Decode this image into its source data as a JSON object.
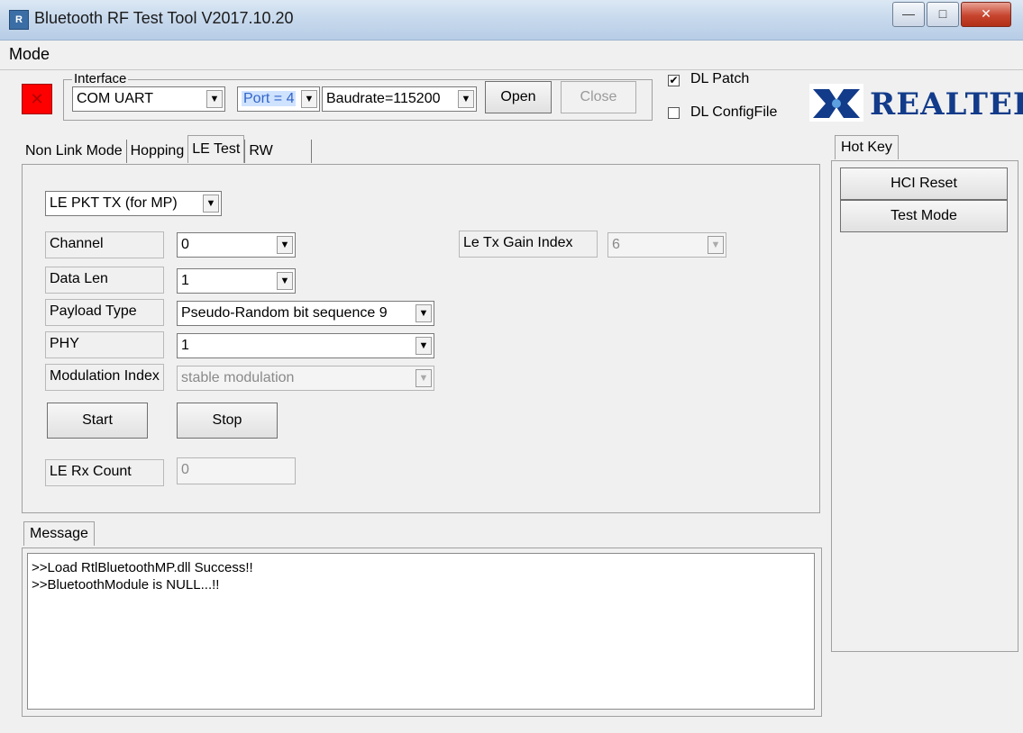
{
  "window": {
    "title": "Bluetooth RF Test Tool V2017.10.20"
  },
  "menu": {
    "mode": "Mode"
  },
  "status": {
    "icon": "red-x-icon",
    "color": "#ff0000"
  },
  "interface": {
    "label": "Interface",
    "type_value": "COM UART",
    "port_value": "Port = 4",
    "baud_value": "Baudrate=115200",
    "open_label": "Open",
    "close_label": "Close"
  },
  "options": {
    "dl_patch": {
      "label": "DL Patch",
      "checked": true
    },
    "dl_configfile": {
      "label": "DL ConfigFile",
      "checked": false
    }
  },
  "logo": {
    "text": "REALTEK",
    "color": "#123b8a"
  },
  "tabs": [
    "Non Link Mode",
    "Hopping",
    "LE Test",
    "RW"
  ],
  "le_test": {
    "mode_value": "LE PKT TX (for MP)",
    "channel_label": "Channel",
    "channel_value": "0",
    "datalen_label": "Data Len",
    "datalen_value": "1",
    "payload_label": "Payload Type",
    "payload_value": "Pseudo-Random bit sequence 9",
    "phy_label": "PHY",
    "phy_value": "1",
    "mod_label": "Modulation Index",
    "mod_value": "stable modulation",
    "gain_label": "Le Tx Gain Index",
    "gain_value": "6",
    "start_label": "Start",
    "stop_label": "Stop",
    "rx_label": "LE Rx Count",
    "rx_value": "0"
  },
  "hotkey": {
    "tab": "Hot Key",
    "hci_reset": "HCI Reset",
    "test_mode": "Test Mode"
  },
  "message": {
    "tab": "Message",
    "lines": [
      ">>Load RtlBluetoothMP.dll Success!!",
      ">>BluetoothModule is NULL...!!"
    ]
  }
}
